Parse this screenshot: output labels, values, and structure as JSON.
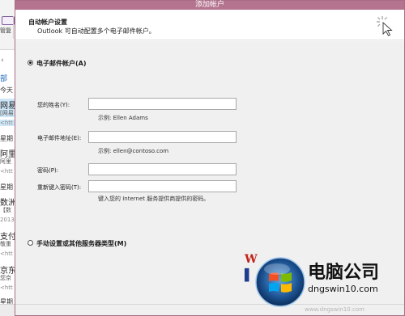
{
  "background_window": {
    "ribbon_label": "管复",
    "mail_list": [
      {
        "text": "部",
        "style": "accent"
      },
      {
        "text": "今天",
        "style": "heading"
      },
      {
        "text": "网易",
        "style": "sender"
      },
      {
        "text": "[网易",
        "style": "sub"
      },
      {
        "text": "<htt",
        "style": "url"
      },
      {
        "text": "星期",
        "style": "heading"
      },
      {
        "text": "阿里",
        "style": "sender"
      },
      {
        "text": "阿里",
        "style": "sub"
      },
      {
        "text": "<htt",
        "style": "url"
      },
      {
        "text": "星期",
        "style": "heading"
      },
      {
        "text": "数洲",
        "style": "sender"
      },
      {
        "text": "【数",
        "style": "sub"
      },
      {
        "text": "2013",
        "style": "url"
      },
      {
        "text": "支付",
        "style": "sender"
      },
      {
        "text": "敬重",
        "style": "sub"
      },
      {
        "text": "<htt",
        "style": "url"
      },
      {
        "text": "京东",
        "style": "sender"
      },
      {
        "text": "您京",
        "style": "sub"
      },
      {
        "text": "<htt",
        "style": "url"
      },
      {
        "text": "星期",
        "style": "heading"
      },
      {
        "text": "<htt",
        "style": "url"
      }
    ]
  },
  "dialog": {
    "title": "添加帐户",
    "header": {
      "title": "自动帐户设置",
      "subtitle": "Outlook 可自动配置多个电子邮件帐户。"
    },
    "email_account_option": {
      "label": "电子邮件帐户(A)",
      "selected": true
    },
    "fields": {
      "name": {
        "label": "您的姓名(Y):",
        "value": "",
        "hint": "示例: Ellen Adams"
      },
      "email": {
        "label": "电子邮件地址(E):",
        "value": "",
        "hint": "示例: ellen@contoso.com"
      },
      "password": {
        "label": "密码(P):",
        "value": ""
      },
      "password_confirm": {
        "label": "重新键入密码(T):",
        "value": ""
      },
      "password_hint": "键入您的 Internet 服务提供商提供的密码。"
    },
    "manual_option": {
      "label": "手动设置或其他服务器类型(M)",
      "selected": false
    }
  },
  "watermark": {
    "brand": "电脑公司",
    "url": "dngswin10.com",
    "url_faint": "www.dngswin10.com"
  }
}
